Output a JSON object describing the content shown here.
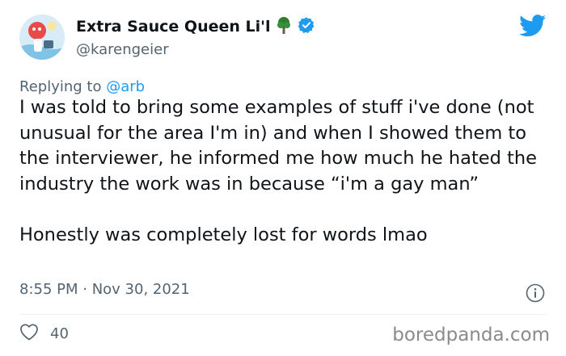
{
  "user": {
    "display_name": "Extra Sauce Queen Li'l",
    "handle": "@karengeier",
    "verified": true
  },
  "reply": {
    "prefix": "Replying to",
    "mention": "@arb"
  },
  "tweet": {
    "text": "I was told to bring some examples of stuff i've done (not unusual for the area I'm in) and when I showed them to the interviewer, he informed me how much he hated the industry the work was in because “i'm a gay man”\n\nHonestly was completely lost for words lmao",
    "timestamp": "8:55 PM · Nov 30, 2021"
  },
  "stats": {
    "likes": "40"
  },
  "watermark": "boredpanda.com",
  "colors": {
    "twitter_blue": "#1d9bf0",
    "secondary_text": "#536471",
    "tree_green": "#2e7d32"
  },
  "icons": [
    "tree-icon",
    "verified-badge-icon",
    "twitter-logo-icon",
    "info-icon",
    "heart-icon"
  ]
}
